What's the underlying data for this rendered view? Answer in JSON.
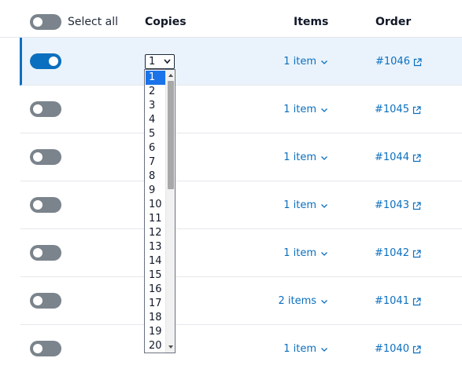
{
  "header": {
    "select_all_label": "Select all",
    "columns": {
      "copies": "Copies",
      "items": "Items",
      "order": "Order"
    }
  },
  "copies_select": {
    "selected_value": "1",
    "options": [
      "1",
      "2",
      "3",
      "4",
      "5",
      "6",
      "7",
      "8",
      "9",
      "10",
      "11",
      "12",
      "13",
      "14",
      "15",
      "16",
      "17",
      "18",
      "19",
      "20"
    ],
    "highlighted_option": "1"
  },
  "rows": [
    {
      "selected": true,
      "items_label": "1 item",
      "order_label": "#1046"
    },
    {
      "selected": false,
      "items_label": "1 item",
      "order_label": "#1045"
    },
    {
      "selected": false,
      "items_label": "1 item",
      "order_label": "#1044"
    },
    {
      "selected": false,
      "items_label": "1 item",
      "order_label": "#1043"
    },
    {
      "selected": false,
      "items_label": "1 item",
      "order_label": "#1042"
    },
    {
      "selected": false,
      "items_label": "2 items",
      "order_label": "#1041"
    },
    {
      "selected": false,
      "items_label": "1 item",
      "order_label": "#1040"
    }
  ],
  "colors": {
    "accent": "#0b6fbf",
    "toggle_off": "#7b848c",
    "selected_row_bg": "#eaf3fb",
    "highlight_option": "#1a73e8"
  },
  "icons": {
    "items_chevron": "chevron-down-icon",
    "order_link": "external-link-icon",
    "select_arrow": "caret-down-icon"
  }
}
